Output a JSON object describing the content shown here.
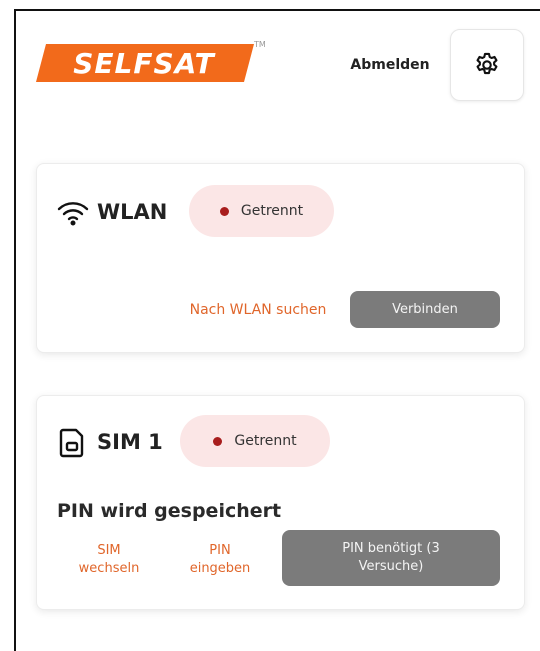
{
  "header": {
    "brand": "SELFSAT",
    "trademark": "TM",
    "logout_label": "Abmelden"
  },
  "wlan": {
    "title": "WLAN",
    "status": "Getrennt",
    "search_label": "Nach WLAN suchen",
    "connect_label": "Verbinden"
  },
  "sim": {
    "title": "SIM 1",
    "status": "Getrennt",
    "subtitle": "PIN wird gespeichert",
    "switch_label_1": "SIM",
    "switch_label_2": "wechseln",
    "pin_label_1": "PIN",
    "pin_label_2": "eingeben",
    "pin_required_1": "PIN benötigt (3",
    "pin_required_2": "Versuche)"
  },
  "colors": {
    "brand_orange": "#f26a1b",
    "link_orange": "#e0662b",
    "status_dot": "#a81d1d",
    "status_bg": "#fbe6e6",
    "button_grey": "#7b7b7b"
  },
  "icons": {
    "settings": "gear-icon",
    "wlan": "wifi-icon",
    "sim": "sim-card-icon"
  }
}
